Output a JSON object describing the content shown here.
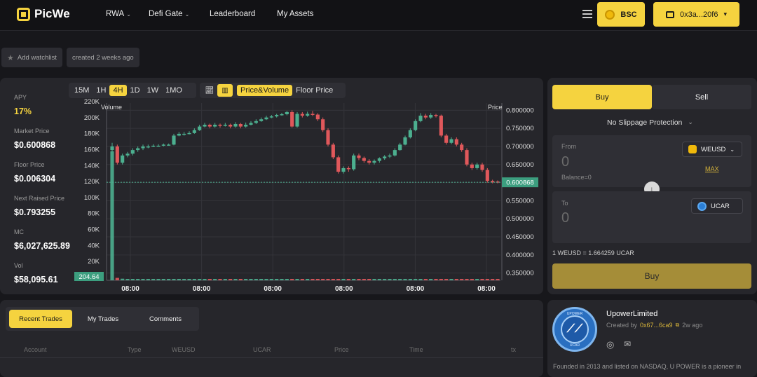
{
  "app": {
    "name": "PicWe"
  },
  "nav": [
    {
      "label": "RWA",
      "dropdown": true
    },
    {
      "label": "Defi Gate",
      "dropdown": true
    },
    {
      "label": "Leaderboard",
      "dropdown": false
    },
    {
      "label": "My Assets",
      "dropdown": false
    }
  ],
  "header": {
    "network_label": "BSC",
    "wallet_label": "0x3a...20f6"
  },
  "chips": {
    "watchlist": "Add watchlist",
    "created": "created 2 weeks ago"
  },
  "stats": [
    {
      "label": "APY",
      "value": "17%"
    },
    {
      "label": "Market Price",
      "value": "$0.600868"
    },
    {
      "label": "Floor Price",
      "value": "$0.006304"
    },
    {
      "label": "Next Raised Price",
      "value": "$0.793255"
    },
    {
      "label": "MC",
      "value": "$6,027,625.89"
    },
    {
      "label": "Vol",
      "value": "$58,095.61"
    }
  ],
  "timeframes": [
    "15M",
    "1H",
    "4H",
    "1D",
    "1W",
    "1MO"
  ],
  "active_timeframe": "4H",
  "view_modes": [
    "Price&Volume",
    "Floor Price"
  ],
  "active_view_mode": "Price&Volume",
  "chart_data": {
    "type": "candlestick",
    "left_axis_label": "Volume",
    "right_axis_label": "Price",
    "volume_ticks": [
      "220K",
      "200K",
      "180K",
      "160K",
      "140K",
      "120K",
      "100K",
      "80K",
      "60K",
      "40K",
      "20K",
      "0"
    ],
    "price_ticks": [
      "0.800000",
      "0.750000",
      "0.700000",
      "0.650000",
      "0.600000",
      "0.550000",
      "0.500000",
      "0.450000",
      "0.400000",
      "0.350000"
    ],
    "x_ticks": [
      "08:00",
      "08:00",
      "08:00",
      "08:00",
      "08:00",
      "08:00"
    ],
    "current_price_label": "0.600868",
    "current_volume_label": "204.64",
    "price_range": [
      0.33,
      0.82
    ],
    "volume_range": [
      0,
      220000
    ],
    "colors": {
      "up": "#4caf8f",
      "down": "#e0585b",
      "grid": "#34343a"
    },
    "candles": [
      [
        0.69,
        0.7,
        0.71,
        0.685,
        160000
      ],
      [
        0.7,
        0.655,
        0.705,
        0.65,
        3000
      ],
      [
        0.655,
        0.675,
        0.68,
        0.65,
        2000
      ],
      [
        0.675,
        0.68,
        0.685,
        0.67,
        1000
      ],
      [
        0.68,
        0.69,
        0.695,
        0.675,
        800
      ],
      [
        0.69,
        0.695,
        0.7,
        0.685,
        600
      ],
      [
        0.695,
        0.7,
        0.705,
        0.69,
        500
      ],
      [
        0.7,
        0.7,
        0.705,
        0.695,
        400
      ],
      [
        0.7,
        0.702,
        0.706,
        0.698,
        400
      ],
      [
        0.702,
        0.702,
        0.706,
        0.699,
        400
      ],
      [
        0.702,
        0.705,
        0.708,
        0.7,
        400
      ],
      [
        0.705,
        0.705,
        0.708,
        0.702,
        400
      ],
      [
        0.705,
        0.73,
        0.735,
        0.703,
        500
      ],
      [
        0.73,
        0.735,
        0.74,
        0.728,
        500
      ],
      [
        0.735,
        0.735,
        0.74,
        0.73,
        400
      ],
      [
        0.735,
        0.737,
        0.742,
        0.733,
        400
      ],
      [
        0.737,
        0.745,
        0.75,
        0.735,
        400
      ],
      [
        0.745,
        0.755,
        0.76,
        0.743,
        400
      ],
      [
        0.755,
        0.76,
        0.765,
        0.753,
        400
      ],
      [
        0.76,
        0.755,
        0.763,
        0.75,
        400
      ],
      [
        0.755,
        0.76,
        0.765,
        0.752,
        400
      ],
      [
        0.76,
        0.757,
        0.763,
        0.752,
        400
      ],
      [
        0.757,
        0.76,
        0.765,
        0.755,
        400
      ],
      [
        0.76,
        0.755,
        0.763,
        0.75,
        400
      ],
      [
        0.755,
        0.762,
        0.767,
        0.752,
        400
      ],
      [
        0.762,
        0.755,
        0.765,
        0.75,
        400
      ],
      [
        0.755,
        0.76,
        0.766,
        0.752,
        400
      ],
      [
        0.76,
        0.765,
        0.77,
        0.758,
        400
      ],
      [
        0.765,
        0.77,
        0.775,
        0.762,
        400
      ],
      [
        0.77,
        0.775,
        0.78,
        0.768,
        400
      ],
      [
        0.775,
        0.78,
        0.785,
        0.773,
        400
      ],
      [
        0.78,
        0.783,
        0.787,
        0.778,
        400
      ],
      [
        0.783,
        0.787,
        0.79,
        0.78,
        400
      ],
      [
        0.787,
        0.789,
        0.793,
        0.785,
        400
      ],
      [
        0.789,
        0.795,
        0.798,
        0.786,
        400
      ],
      [
        0.795,
        0.755,
        0.8,
        0.752,
        600
      ],
      [
        0.755,
        0.79,
        0.795,
        0.752,
        500
      ],
      [
        0.79,
        0.785,
        0.795,
        0.78,
        400
      ],
      [
        0.785,
        0.79,
        0.796,
        0.782,
        400
      ],
      [
        0.79,
        0.788,
        0.798,
        0.784,
        400
      ],
      [
        0.788,
        0.775,
        0.792,
        0.77,
        400
      ],
      [
        0.775,
        0.745,
        0.78,
        0.74,
        500
      ],
      [
        0.745,
        0.705,
        0.75,
        0.7,
        500
      ],
      [
        0.705,
        0.67,
        0.71,
        0.665,
        500
      ],
      [
        0.67,
        0.63,
        0.675,
        0.625,
        500
      ],
      [
        0.63,
        0.64,
        0.645,
        0.625,
        400
      ],
      [
        0.64,
        0.637,
        0.645,
        0.63,
        400
      ],
      [
        0.637,
        0.675,
        0.68,
        0.633,
        500
      ],
      [
        0.675,
        0.668,
        0.68,
        0.662,
        400
      ],
      [
        0.668,
        0.66,
        0.672,
        0.655,
        400
      ],
      [
        0.66,
        0.655,
        0.665,
        0.65,
        400
      ],
      [
        0.655,
        0.66,
        0.664,
        0.65,
        400
      ],
      [
        0.66,
        0.667,
        0.67,
        0.655,
        400
      ],
      [
        0.667,
        0.672,
        0.676,
        0.663,
        400
      ],
      [
        0.672,
        0.675,
        0.68,
        0.668,
        400
      ],
      [
        0.675,
        0.69,
        0.695,
        0.672,
        400
      ],
      [
        0.69,
        0.705,
        0.71,
        0.688,
        400
      ],
      [
        0.705,
        0.725,
        0.73,
        0.703,
        400
      ],
      [
        0.725,
        0.745,
        0.75,
        0.722,
        400
      ],
      [
        0.745,
        0.77,
        0.775,
        0.742,
        500
      ],
      [
        0.77,
        0.785,
        0.792,
        0.767,
        500
      ],
      [
        0.785,
        0.78,
        0.79,
        0.775,
        400
      ],
      [
        0.78,
        0.787,
        0.792,
        0.776,
        400
      ],
      [
        0.787,
        0.785,
        0.79,
        0.78,
        400
      ],
      [
        0.785,
        0.73,
        0.788,
        0.725,
        500
      ],
      [
        0.73,
        0.71,
        0.735,
        0.705,
        500
      ],
      [
        0.71,
        0.72,
        0.725,
        0.706,
        400
      ],
      [
        0.72,
        0.705,
        0.725,
        0.7,
        400
      ],
      [
        0.705,
        0.69,
        0.71,
        0.685,
        400
      ],
      [
        0.69,
        0.65,
        0.695,
        0.645,
        500
      ],
      [
        0.65,
        0.64,
        0.655,
        0.635,
        400
      ],
      [
        0.64,
        0.65,
        0.655,
        0.636,
        400
      ],
      [
        0.65,
        0.635,
        0.655,
        0.63,
        400
      ],
      [
        0.635,
        0.605,
        0.64,
        0.6,
        500
      ],
      [
        0.605,
        0.603,
        0.608,
        0.598,
        400
      ],
      [
        0.603,
        0.601,
        0.606,
        0.598,
        400
      ]
    ]
  },
  "swap": {
    "tab_buy": "Buy",
    "tab_sell": "Sell",
    "slippage_label": "No Slippage Protection",
    "from_label": "From",
    "from_value": "0",
    "from_token": "WEUSD",
    "balance_label": "Balance=0",
    "max_label": "MAX",
    "to_label": "To",
    "to_value": "0",
    "to_token": "UCAR",
    "rate_label": "1 WEUSD = 1.664259 UCAR",
    "submit_label": "Buy"
  },
  "trades": {
    "tabs": [
      "Recent Trades",
      "My Trades",
      "Comments"
    ],
    "active_tab": "Recent Trades",
    "columns": [
      "Account",
      "Type",
      "WEUSD",
      "UCAR",
      "Price",
      "Time",
      "tx"
    ]
  },
  "project": {
    "logo_top_text": "UPOWER",
    "logo_bottom_text": "UCAR",
    "name": "UpowerLimited",
    "created_by_label": "Created by",
    "creator_address": "0x67...6ca9",
    "created_ago": "2w ago",
    "description": "Founded in 2013 and listed on NASDAQ, U POWER is a pioneer in"
  }
}
